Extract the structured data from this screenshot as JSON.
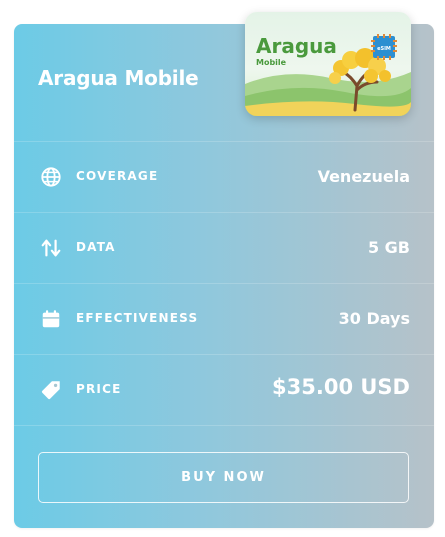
{
  "product": {
    "title": "Aragua Mobile",
    "sim_brand": "Aragua",
    "sim_brand_sub": "Mobile",
    "sim_chip_label": "eSIM"
  },
  "specs": [
    {
      "icon": "globe-icon",
      "label": "COVERAGE",
      "value": "Venezuela"
    },
    {
      "icon": "up-down-arrows-icon",
      "label": "DATA",
      "value": "5 GB"
    },
    {
      "icon": "calendar-icon",
      "label": "EFFECTIVENESS",
      "value": "30 Days"
    },
    {
      "icon": "price-tag-icon",
      "label": "PRICE",
      "value": "$35.00 USD"
    }
  ],
  "actions": {
    "buy_label": "BUY NOW"
  },
  "colors": {
    "gradient_start": "#6ccbe6",
    "gradient_end": "#b6c2c9",
    "text": "#ffffff",
    "brand_green": "#4a9a3d"
  }
}
